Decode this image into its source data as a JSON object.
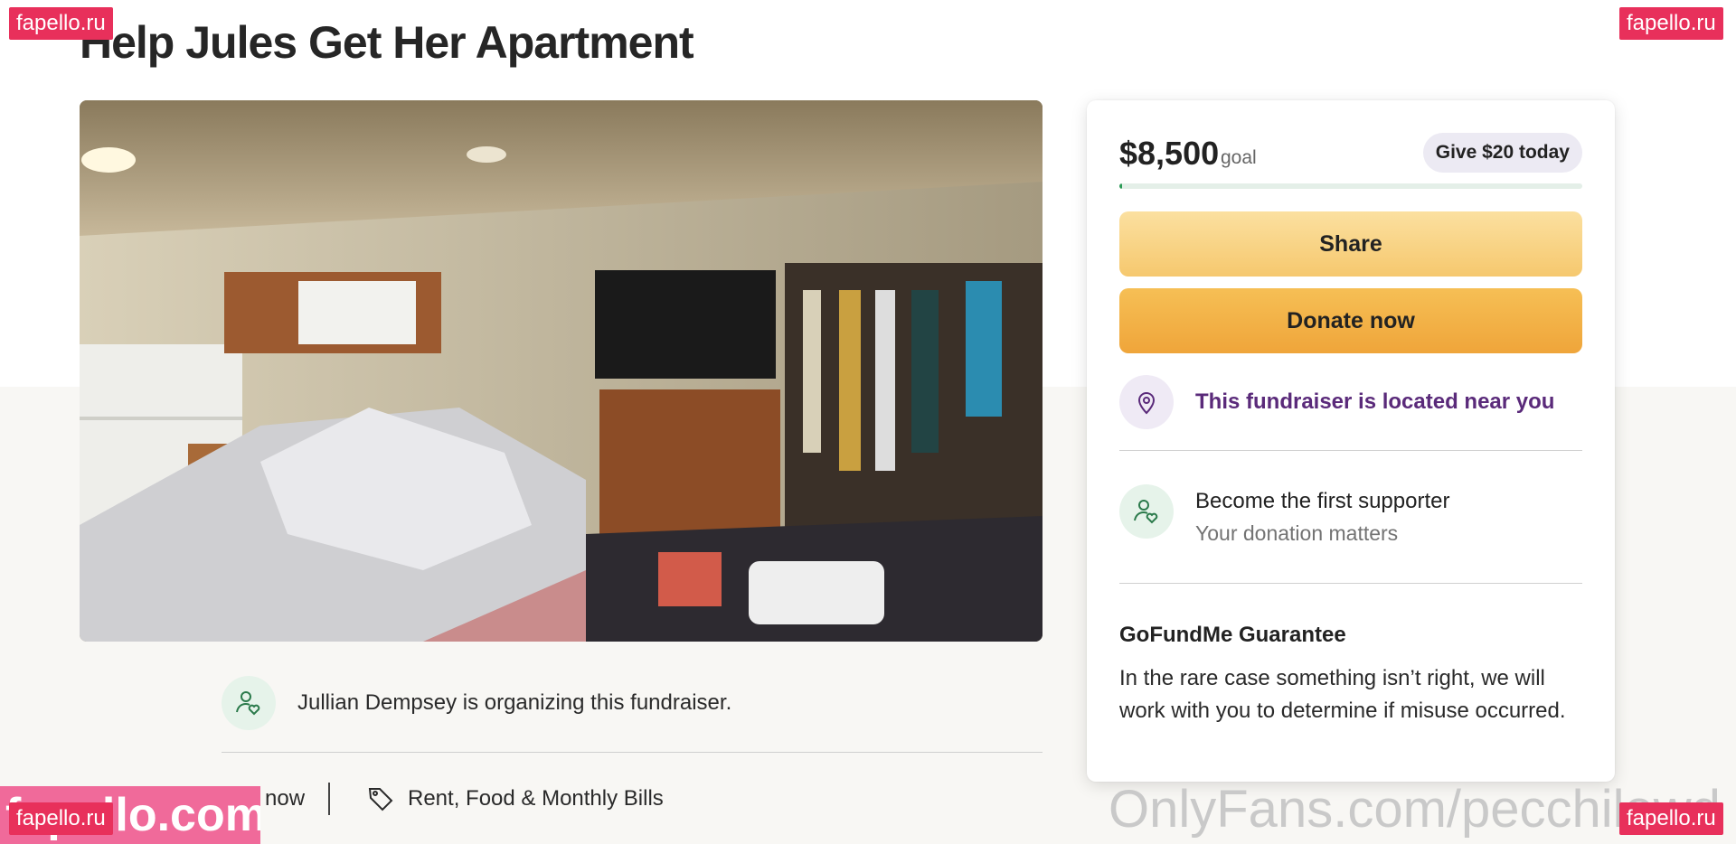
{
  "page": {
    "title": "Help Jules Get Her Apartment"
  },
  "organizer": {
    "text": "Jullian Dempsey is organizing this fundraiser.",
    "icon": "person-heart-icon"
  },
  "meta": {
    "created": "now",
    "category": "Rent, Food & Monthly Bills",
    "tag_icon": "tag-icon"
  },
  "donation": {
    "goal_amount": "$8,500",
    "goal_label": "goal",
    "give_button": "Give $20 today",
    "progress_fraction": 0.005,
    "share_button": "Share",
    "donate_button": "Donate now",
    "location_text": "This fundraiser is located near you",
    "supporter_title": "Become the first supporter",
    "supporter_sub": "Your donation matters",
    "guarantee_title": "GoFundMe Guarantee",
    "guarantee_body": "In the rare case something isn’t right, we will work with you to determine if misuse occurred."
  },
  "watermarks": {
    "badge": "fapello.ru",
    "big": "fapello.com",
    "onlyfans": "OnlyFans.com/pecchilowd"
  },
  "colors": {
    "accent_purple": "#5a2a7a",
    "progress_green": "#2a9a55",
    "share_yellow": "#f6c86e",
    "donate_orange": "#efa53a",
    "watermark_red": "#e8305b"
  }
}
